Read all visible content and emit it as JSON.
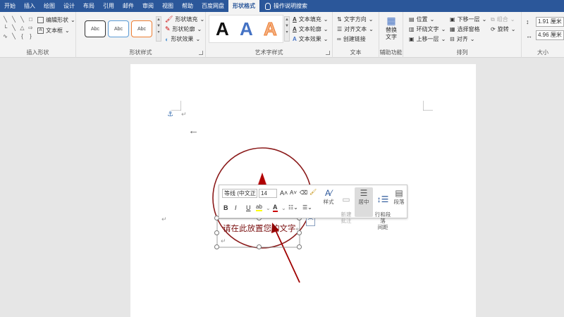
{
  "tabs": [
    "开始",
    "插入",
    "绘图",
    "设计",
    "布局",
    "引用",
    "邮件",
    "审阅",
    "视图",
    "帮助",
    "百度网盘",
    "形状格式"
  ],
  "active_tab": "形状格式",
  "tell_me": "操作说明搜索",
  "ribbon": {
    "insert_shapes": {
      "title": "插入形状",
      "edit_shape": "编辑形状",
      "text_box": "文本框"
    },
    "shape_styles": {
      "title": "形状样式",
      "preset_label": "Abc",
      "fill": "形状填充",
      "outline": "形状轮廓",
      "effects": "形状效果"
    },
    "wordart_styles": {
      "title": "艺术字样式",
      "letter": "A",
      "text_fill": "文本填充",
      "text_outline": "文本轮廓",
      "text_effects": "文本效果"
    },
    "text": {
      "title": "文本",
      "direction": "文字方向",
      "align": "对齐文本",
      "link": "创建链接"
    },
    "accessibility": {
      "title": "辅助功能",
      "alt_text": "替换文字"
    },
    "arrange": {
      "title": "排列",
      "position": "位置",
      "wrap": "环绕文字",
      "forward": "上移一层",
      "backward": "下移一层",
      "selection_pane": "选择窗格",
      "align": "对齐",
      "group": "组合",
      "rotate": "旋转"
    },
    "size": {
      "title": "大小",
      "height": "1.91 厘米",
      "width": "4.96 厘米"
    }
  },
  "document": {
    "textbox_text": "请在此放置您的文字",
    "pilcrow": "↵"
  },
  "mini_toolbar": {
    "font": "等线 (中文正",
    "size": "14",
    "bold": "B",
    "italic": "I",
    "underline": "U",
    "styles": "样式",
    "new_comment": "新建\n批注",
    "center": "居中",
    "line_spacing": "行和段落\n间距",
    "paragraph": "段落"
  },
  "colors": {
    "accent_blue": "#2b579a",
    "shape_fill": "#f5c6cb",
    "annotation_red": "#8b0000",
    "textbox_text": "#7a0f0f"
  }
}
